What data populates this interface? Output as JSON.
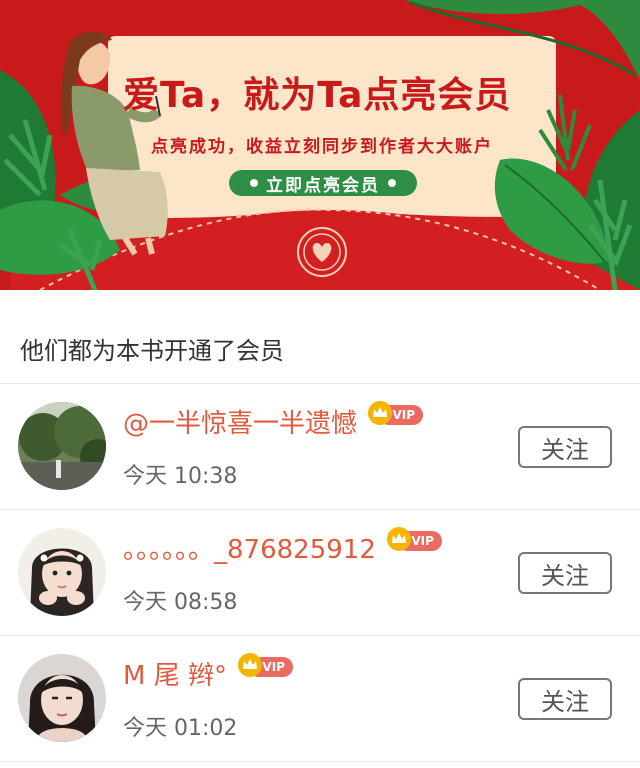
{
  "banner": {
    "title": "爱Ta，就为Ta点亮会员",
    "subtitle": "点亮成功，收益立刻同步到作者大大账户",
    "cta_label": "立即点亮会员"
  },
  "section": {
    "title": "他们都为本书开通了会员"
  },
  "follow_label": "关注",
  "vip_label": "VIP",
  "members": [
    {
      "name": "@一半惊喜一半遗憾",
      "time": "今天 10:38"
    },
    {
      "name": "。。。。。。_876825912",
      "time": "今天 08:58"
    },
    {
      "name": "M 尾 辫°",
      "time": "今天 01:02"
    }
  ],
  "colors": {
    "banner_red": "#c8191b",
    "cta_green": "#2f8e46",
    "name_orange": "#e15a3f",
    "vip_badge": "#eb6a62"
  }
}
